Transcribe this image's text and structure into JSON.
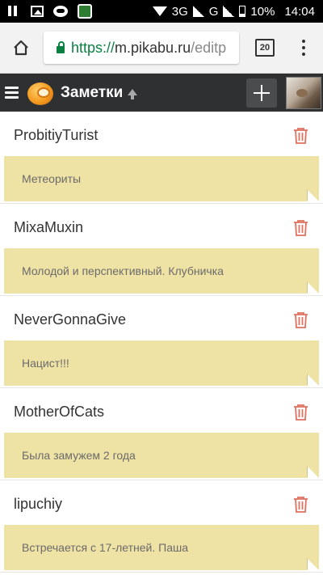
{
  "status_bar": {
    "network": "3G",
    "network2": "G",
    "battery": "10%",
    "time": "14:04"
  },
  "browser": {
    "url_scheme": "https://",
    "url_host": "m.pikabu.ru",
    "url_path": "/editp",
    "tab_count": "20"
  },
  "app": {
    "title": "Заметки"
  },
  "notes": [
    {
      "name": "ProbitiyTurist",
      "text": "Метеориты"
    },
    {
      "name": "MixaMuxin",
      "text": "Молодой и перспективный. Клубничка"
    },
    {
      "name": "NeverGonnaGive",
      "text": "Нацист!!!"
    },
    {
      "name": "MotherOfCats",
      "text": "Была замужем 2 года"
    },
    {
      "name": "lipuchiy",
      "text": "Встречается с 17-летней. Паша"
    }
  ],
  "colors": {
    "note_background": "#efe2a5",
    "header_background": "#2e3032",
    "trash_icon": "#e0705f",
    "url_secure": "#0b8043"
  }
}
